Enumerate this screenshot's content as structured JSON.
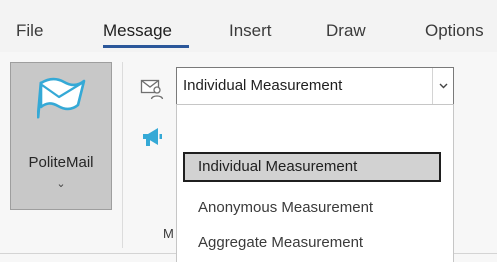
{
  "tabs": [
    {
      "label": "File",
      "active": false
    },
    {
      "label": "Message",
      "active": true
    },
    {
      "label": "Insert",
      "active": false
    },
    {
      "label": "Draw",
      "active": false
    },
    {
      "label": "Options",
      "active": false
    }
  ],
  "ribbon": {
    "politemail": {
      "label": "PoliteMail",
      "icon": "flag-envelope-icon",
      "chevron": "⌄"
    },
    "measurement_select": {
      "value": "Individual Measurement",
      "icon": "envelope-person-icon"
    },
    "broadcast_icon": "megaphone-icon",
    "group_label": "M"
  },
  "dropdown": {
    "options": [
      {
        "label": "Individual Measurement",
        "selected": true
      },
      {
        "label": "Anonymous Measurement",
        "selected": false
      },
      {
        "label": "Aggregate Measurement",
        "selected": false
      }
    ]
  },
  "colors": {
    "accent": "#2b579a",
    "politemail_icon": "#35a9d6",
    "button_pressed_bg": "#c8c8c8"
  }
}
